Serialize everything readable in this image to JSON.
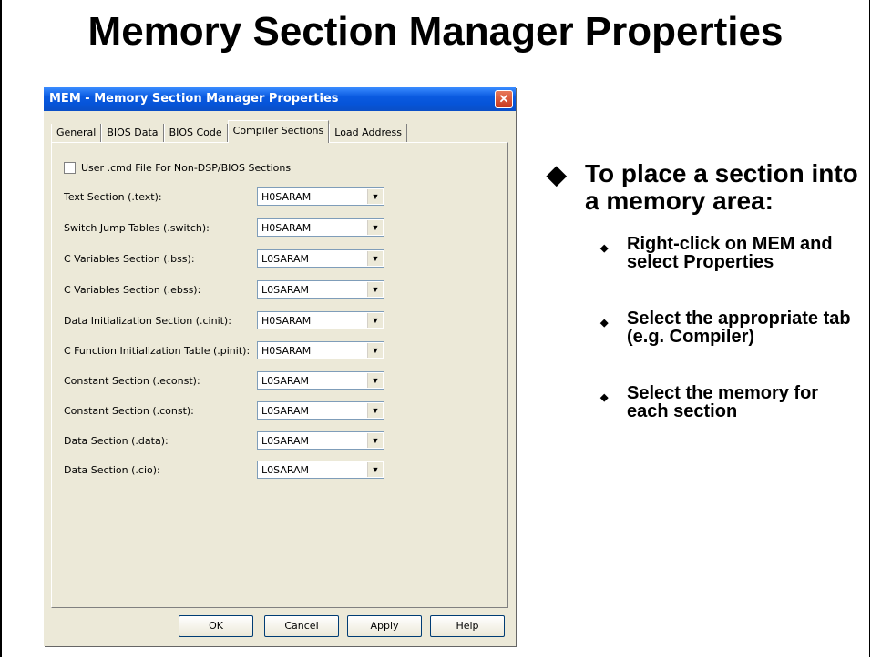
{
  "slide": {
    "title": "Memory Section Manager Properties",
    "main_bullet": "To place a section into a memory area:",
    "sub_bullets": [
      "Right-click on MEM and select Properties",
      "Select the appropriate tab (e.g. Compiler)",
      "Select the memory for each section"
    ]
  },
  "dialog": {
    "title": "MEM - Memory Section Manager Properties",
    "close_glyph": "✕",
    "tabs": [
      "General",
      "BIOS Data",
      "BIOS Code",
      "Compiler Sections",
      "Load Address"
    ],
    "active_tab": "Compiler Sections",
    "checkbox_label": "User .cmd File For Non-DSP/BIOS Sections",
    "checkbox_checked": false,
    "rows": [
      {
        "label": "Text Section (.text):",
        "value": "H0SARAM"
      },
      {
        "label": "Switch Jump Tables (.switch):",
        "value": "H0SARAM"
      },
      {
        "label": "C Variables Section (.bss):",
        "value": "L0SARAM"
      },
      {
        "label": "C Variables Section (.ebss):",
        "value": "L0SARAM"
      },
      {
        "label": "Data Initialization Section (.cinit):",
        "value": "H0SARAM"
      },
      {
        "label": "C Function Initialization Table (.pinit):",
        "value": "H0SARAM"
      },
      {
        "label": "Constant Section (.econst):",
        "value": "L0SARAM"
      },
      {
        "label": "Constant Section (.const):",
        "value": "L0SARAM"
      },
      {
        "label": "Data Section (.data):",
        "value": "L0SARAM"
      },
      {
        "label": "Data Section (.cio):",
        "value": "L0SARAM"
      }
    ],
    "buttons": {
      "ok": "OK",
      "cancel": "Cancel",
      "apply": "Apply",
      "help": "Help"
    }
  },
  "colors": {
    "titlebar": "#0a5ae0",
    "dialog_bg": "#ece9d8",
    "close": "#c8381c"
  },
  "icons": {
    "close": "close-icon",
    "dropdown": "chevron-down-icon",
    "main_bullet": "diamond-bullet-icon",
    "sub_bullet": "small-diamond-bullet-icon"
  }
}
